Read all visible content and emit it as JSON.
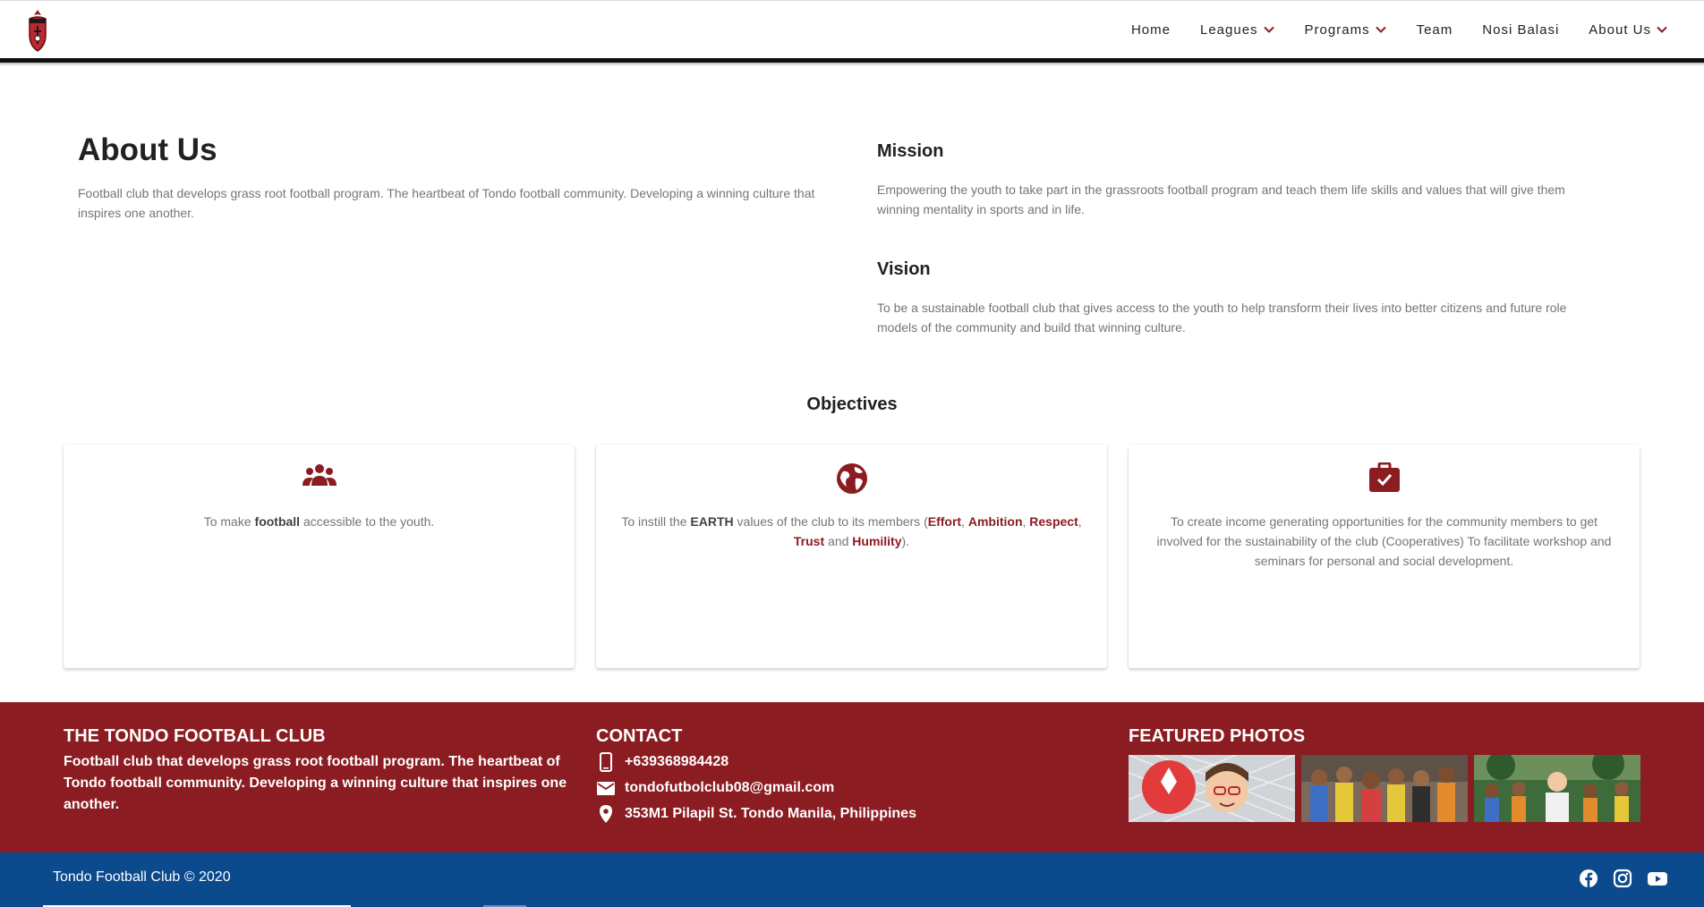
{
  "nav": {
    "items": [
      {
        "label": "Home",
        "dropdown": false
      },
      {
        "label": "Leagues",
        "dropdown": true
      },
      {
        "label": "Programs",
        "dropdown": true
      },
      {
        "label": "Team",
        "dropdown": false
      },
      {
        "label": "Nosi Balasi",
        "dropdown": false
      },
      {
        "label": "About Us",
        "dropdown": true
      }
    ],
    "accent": "#8b1c21"
  },
  "about": {
    "title": "About Us",
    "text": "Football club that develops grass root football program. The heartbeat of Tondo football community. Developing a winning culture that inspires one another."
  },
  "mission": {
    "title": "Mission",
    "text": "Empowering the youth to take part in the grassroots football program and teach them life skills and values that will give them winning mentality in sports and in life."
  },
  "vision": {
    "title": "Vision",
    "text": "To be a sustainable football club that gives access to the youth to help transform their lives into better citizens and future role models of the community and build that winning culture."
  },
  "objectives": {
    "title": "Objectives",
    "cards": [
      {
        "icon": "group-icon",
        "pre": "To make ",
        "bold": "football",
        "post": " accessible to the youth."
      },
      {
        "icon": "globe-icon",
        "pre": "To instill the ",
        "bold": "EARTH",
        "mid": " values of the club to its members (",
        "v1": "Effort",
        "sep1": ", ",
        "v2": "Ambition",
        "sep2": ", ",
        "v3": "Respect",
        "sep3": ",",
        "v4": "Trust",
        "sep4": " and ",
        "v5": "Humility",
        "end": ")."
      },
      {
        "icon": "briefcase-check-icon",
        "text": "To create income generating opportunities for the community members to get involved for the sustainability of the club (Cooperatives) To facilitate workshop and seminars for personal and social development."
      }
    ]
  },
  "footer": {
    "club_title": "THE TONDO FOOTBALL CLUB",
    "club_desc": "Football club that develops grass root football program. The heartbeat of Tondo football community. Developing a winning culture that inspires one another.",
    "contact_title": "CONTACT",
    "phone": "+639368984428",
    "email": "tondofutbolclub08@gmail.com",
    "address": "353M1 Pilapil St. Tondo Manila, Philippines",
    "photos_title": "FEATURED PHOTOS",
    "bg_color": "#8b1c21"
  },
  "bottom": {
    "copyright": "Tondo Football Club © 2020",
    "socials": [
      "facebook-icon",
      "instagram-icon",
      "youtube-icon"
    ],
    "bg_color": "#0b4a8c"
  }
}
